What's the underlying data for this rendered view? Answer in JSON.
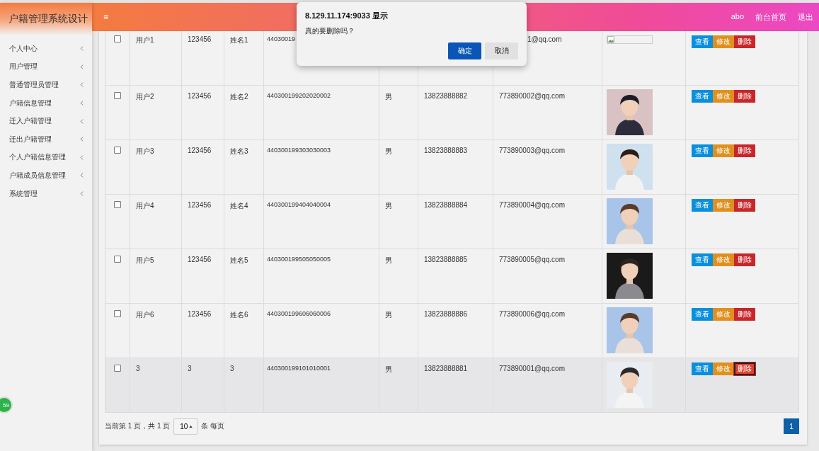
{
  "app_title": "户籍管理系统设计",
  "header": {
    "menu_glyph": "≡",
    "links": [
      "abo",
      "前台首页",
      "退出"
    ]
  },
  "sidebar": {
    "items": [
      {
        "label": "个人中心",
        "expanded": false
      },
      {
        "label": "用户管理",
        "expanded": false
      },
      {
        "label": "普通管理员管理",
        "expanded": false
      },
      {
        "label": "户籍信息管理",
        "expanded": false
      },
      {
        "label": "迁入户籍管理",
        "expanded": false
      },
      {
        "label": "迁出户籍管理",
        "expanded": false
      },
      {
        "label": "个人户籍信息管理",
        "expanded": false
      },
      {
        "label": "户籍成员信息管理",
        "expanded": false
      },
      {
        "label": "系统管理",
        "expanded": false
      }
    ],
    "badge": "59"
  },
  "table": {
    "rows": [
      {
        "checked": false,
        "highlighted": false,
        "under_dialog": true,
        "cells": [
          "用户1",
          "123456",
          "姓名1",
          "44030019",
          null,
          null,
          "1@qq.com"
        ],
        "photo": {
          "kind": "broken"
        },
        "actions": [
          {
            "label": "查看",
            "kind": "view",
            "focused": false
          },
          {
            "label": "修改",
            "kind": "edit",
            "focused": false
          },
          {
            "label": "删除",
            "kind": "delete",
            "focused": false
          }
        ]
      },
      {
        "checked": false,
        "highlighted": false,
        "under_dialog": false,
        "cells": [
          "用户2",
          "123456",
          "姓名2",
          "440300199202020002",
          "男",
          "13823888882",
          "773890002@qq.com"
        ],
        "actions": [
          {
            "label": "查看",
            "kind": "view",
            "focused": false
          },
          {
            "label": "修改",
            "kind": "edit",
            "focused": false
          },
          {
            "label": "删除",
            "kind": "delete",
            "focused": false
          }
        ]
      },
      {
        "checked": false,
        "highlighted": false,
        "under_dialog": false,
        "cells": [
          "用户3",
          "123456",
          "姓名3",
          "440300199303030003",
          "男",
          "13823888883",
          "773890003@qq.com"
        ],
        "actions": [
          {
            "label": "查看",
            "kind": "view",
            "focused": false
          },
          {
            "label": "修改",
            "kind": "edit",
            "focused": false
          },
          {
            "label": "删除",
            "kind": "delete",
            "focused": false
          }
        ]
      },
      {
        "checked": false,
        "highlighted": false,
        "under_dialog": false,
        "cells": [
          "用户4",
          "123456",
          "姓名4",
          "440300199404040004",
          "男",
          "13823888884",
          "773890004@qq.com"
        ],
        "actions": [
          {
            "label": "查看",
            "kind": "view",
            "focused": false
          },
          {
            "label": "修改",
            "kind": "edit",
            "focused": false
          },
          {
            "label": "删除",
            "kind": "delete",
            "focused": false
          }
        ]
      },
      {
        "checked": false,
        "highlighted": false,
        "under_dialog": false,
        "cells": [
          "用户5",
          "123456",
          "姓名5",
          "440300199505050005",
          "男",
          "13823888885",
          "773890005@qq.com"
        ],
        "actions": [
          {
            "label": "查看",
            "kind": "view",
            "focused": false
          },
          {
            "label": "修改",
            "kind": "edit",
            "focused": false
          },
          {
            "label": "删除",
            "kind": "delete",
            "focused": false
          }
        ]
      },
      {
        "checked": false,
        "highlighted": false,
        "under_dialog": false,
        "cells": [
          "用户6",
          "123456",
          "姓名6",
          "440300199606060006",
          "男",
          "13823888886",
          "773890006@qq.com"
        ],
        "actions": [
          {
            "label": "查看",
            "kind": "view",
            "focused": false
          },
          {
            "label": "修改",
            "kind": "edit",
            "focused": false
          },
          {
            "label": "删除",
            "kind": "delete",
            "focused": false
          }
        ]
      },
      {
        "checked": false,
        "highlighted": true,
        "under_dialog": false,
        "cells": [
          "3",
          "3",
          "3",
          "440300199101010001",
          "男",
          "13823888881",
          "773890001@qq.com"
        ],
        "actions": [
          {
            "label": "查看",
            "kind": "view",
            "focused": false
          },
          {
            "label": "修改",
            "kind": "edit",
            "focused": false
          },
          {
            "label": "删除",
            "kind": "delete",
            "focused": true
          }
        ]
      }
    ]
  },
  "pagination": {
    "summary": "当前第 1 页，共 1 页",
    "page_size": "10",
    "per_page": "条 每页",
    "pages": [
      {
        "label": "1",
        "selected": true
      }
    ]
  },
  "dialog": {
    "title": "8.129.11.174:9033 显示",
    "message": "真的要删除吗？",
    "buttons": [
      {
        "label": "确定",
        "kind": "primary"
      },
      {
        "label": "取消",
        "kind": "secondary"
      }
    ]
  }
}
